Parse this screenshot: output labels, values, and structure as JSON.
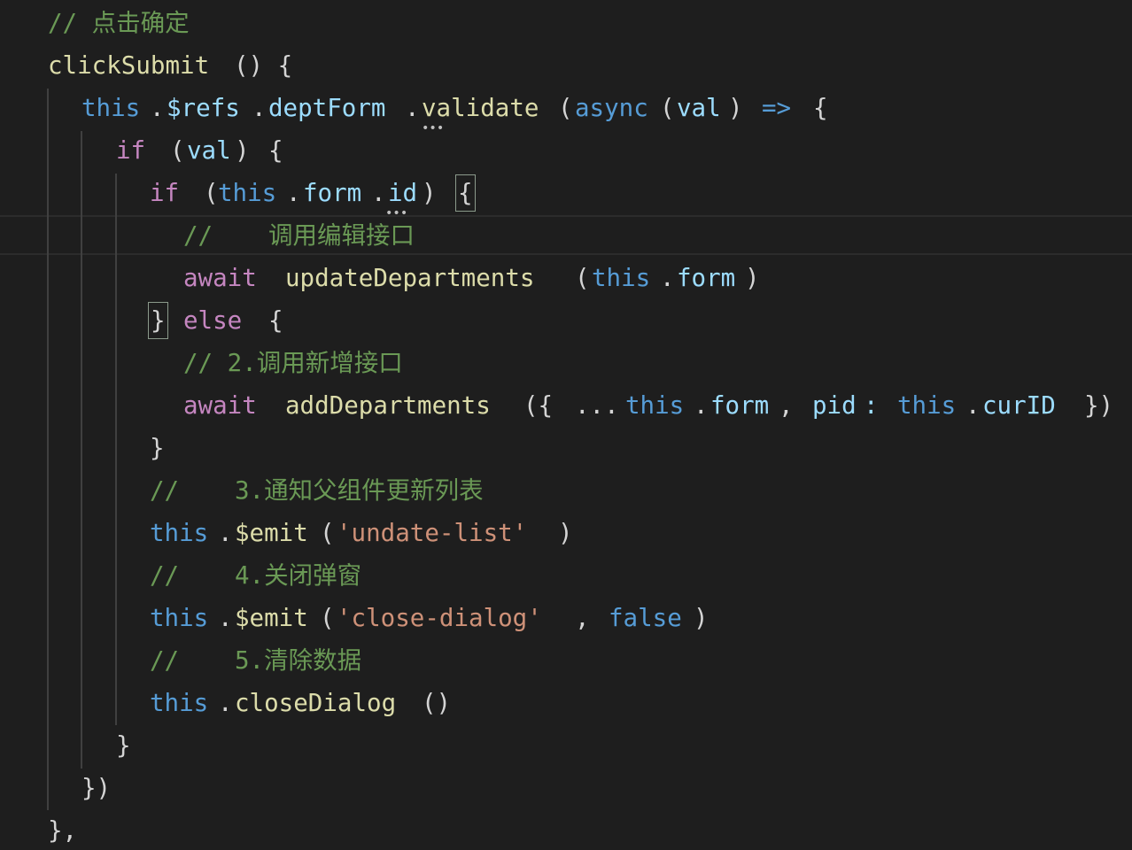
{
  "colors": {
    "background": "#1e1e1e",
    "comment": "#6a9955",
    "function": "#dcdcaa",
    "keyword_this": "#569cd6",
    "property": "#9cdcfe",
    "control_keyword": "#c586c0",
    "string": "#ce9178",
    "punctuation": "#d4d4d4"
  },
  "code": {
    "l1": {
      "comment": "// 点击确定"
    },
    "l2": {
      "fn": "clickSubmit",
      "rest": "() {"
    },
    "l3": {
      "this": "this",
      "dot1": ".",
      "refs": "$refs",
      "dot2": ".",
      "form": "deptForm",
      "dot3": ".",
      "fn": "validate",
      "p1": "(",
      "async": "async",
      "p2": "(",
      "arg": "val",
      "p3": ")",
      "arrow": "=>",
      "brace": "{"
    },
    "l4": {
      "kw": "if",
      "p1": "(",
      "arg": "val",
      "p2": ")",
      "brace": "{"
    },
    "l5": {
      "kw": "if",
      "p1": "(",
      "this": "this",
      "dot1": ".",
      "form": "form",
      "dot2": ".",
      "id": "id",
      "p2": ")",
      "brace": "{"
    },
    "l6": {
      "comment_slash": "//",
      "comment_text": "调用编辑接口"
    },
    "l7": {
      "kw": "await",
      "fn": "updateDepartments",
      "p1": "(",
      "this": "this",
      "dot": ".",
      "form": "form",
      "p2": ")"
    },
    "l8": {
      "brace": "}",
      "kw": "else",
      "brace2": "{"
    },
    "l9": {
      "comment": "// 2.调用新增接口"
    },
    "l10": {
      "kw": "await",
      "fn": "addDepartments",
      "p1": "({",
      "spread": "...",
      "this1": "this",
      "dot1": ".",
      "form": "form",
      "comma": ",",
      "pid": "pid",
      "colon": ":",
      "this2": "this",
      "dot2": ".",
      "curid": "curID",
      "p2": "})"
    },
    "l11": {
      "brace": "}"
    },
    "l12": {
      "comment_slash": "//",
      "comment_text": "3.通知父组件更新列表"
    },
    "l13": {
      "this": "this",
      "dot": ".",
      "fn": "$emit",
      "p1": "(",
      "str": "'undate-list'",
      "p2": ")"
    },
    "l14": {
      "comment_slash": "//",
      "comment_text": "4.关闭弹窗"
    },
    "l15": {
      "this": "this",
      "dot": ".",
      "fn": "$emit",
      "p1": "(",
      "str": "'close-dialog'",
      "comma": ",",
      "bool": "false",
      "p2": ")"
    },
    "l16": {
      "comment_slash": "//",
      "comment_text": "5.清除数据"
    },
    "l17": {
      "this": "this",
      "dot": ".",
      "fn": "closeDialog",
      "p": "()"
    },
    "l18": {
      "brace": "}"
    },
    "l19": {
      "brace": "})"
    },
    "l20": {
      "brace": "},"
    }
  }
}
